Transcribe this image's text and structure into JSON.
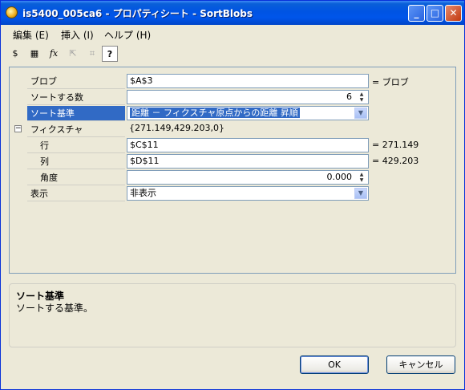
{
  "window": {
    "title": "is5400_005ca6 - プロパティシート - SortBlobs"
  },
  "titlebar": {
    "minimize": "_",
    "maximize": "□",
    "close": "✕"
  },
  "menu": {
    "items": [
      "編集 (E)",
      "挿入 (I)",
      "ヘルプ (H)"
    ]
  },
  "toolbar": {
    "tools": [
      {
        "icon": "variable-icon",
        "glyph": "$",
        "enabled": true
      },
      {
        "icon": "grid-icon",
        "glyph": "▦",
        "enabled": true
      },
      {
        "icon": "function-icon",
        "glyph": "fx",
        "enabled": true
      },
      {
        "icon": "select-arrow-icon",
        "glyph": "⇱",
        "enabled": false
      },
      {
        "icon": "region-select-icon",
        "glyph": "⌗",
        "enabled": false
      },
      {
        "icon": "help-icon",
        "glyph": "?",
        "enabled": true
      }
    ]
  },
  "properties": [
    {
      "label": "ブロブ",
      "value": "$A$3",
      "extra": "= ブロブ"
    },
    {
      "label": "ソートする数",
      "value": "6"
    },
    {
      "label": "ソート基準",
      "value": "距離 － フィクスチャ原点からの距離 昇順"
    },
    {
      "label": "フィクスチャ",
      "value": "{271.149,429.203,0}"
    },
    {
      "label": "行",
      "value": "$C$11",
      "extra": "= 271.149"
    },
    {
      "label": "列",
      "value": "$D$11",
      "extra": "= 429.203"
    },
    {
      "label": "角度",
      "value": "0.000"
    },
    {
      "label": "表示",
      "value": "非表示"
    }
  ],
  "expander": {
    "symbol": "−"
  },
  "description": {
    "title": "ソート基準",
    "text": "ソートする基準。"
  },
  "buttons": {
    "ok": "OK",
    "cancel": "キャンセル"
  }
}
